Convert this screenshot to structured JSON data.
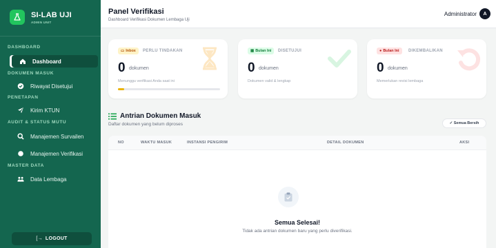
{
  "brand": {
    "title": "SI-LAB UJI",
    "subtitle": "ADMIN UNIT"
  },
  "sidebar": {
    "sections": [
      {
        "label": "DASHBOARD"
      },
      {
        "label": "DOKUMEN MASUK"
      },
      {
        "label": "PENETAPAN"
      },
      {
        "label": "AUDIT & STATUS MUTU"
      },
      {
        "label": "MASTER DATA"
      }
    ],
    "items": [
      {
        "label": "Dashboard",
        "icon": "home-icon",
        "active": true
      },
      {
        "label": "Riwayat Disetujui",
        "icon": "check-circle-icon"
      },
      {
        "label": "Kirim KTUN",
        "icon": "send-icon"
      },
      {
        "label": "Manajemen Survailen",
        "icon": "search-icon"
      },
      {
        "label": "Manajemen Verifikasi",
        "icon": "shield-check-icon"
      },
      {
        "label": "Data Lembaga",
        "icon": "users-icon"
      }
    ],
    "logout_label": "LOGOUT",
    "logout_glyph": "[→"
  },
  "header": {
    "title": "Panel Verifikasi",
    "subtitle": "Dashboard Verifikasi Dokumen Lembaga Uji",
    "user_name": "Administrator",
    "avatar_letter": "A"
  },
  "cards": [
    {
      "badge": "Inbox",
      "label": "PERLU TINDAKAN",
      "value": "0",
      "unit": "dokumen",
      "desc": "Menunggu verifikasi Anda saat ini",
      "progress_fraction": 0.06,
      "accent": "#eab308",
      "icon": "hourglass-icon"
    },
    {
      "badge": "Bulan Ini",
      "label": "DISETUJUI",
      "value": "0",
      "unit": "dokumen",
      "desc": "Dokumen valid & lengkap",
      "accent": "#22c55e",
      "icon": "check-icon"
    },
    {
      "badge": "Bulan Ini",
      "label": "DIKEMBALIKAN",
      "value": "0",
      "unit": "dokumen",
      "desc": "Memerlukan revisi lembaga",
      "accent": "#ef4444",
      "icon": "undo-icon"
    }
  ],
  "queue": {
    "title": "Antrian Dokumen Masuk",
    "subtitle": "Daftar dokumen yang belum diproses",
    "pill": "✓ Semua Bersih",
    "columns": [
      "NO",
      "WAKTU MASUK",
      "INSTANSI PENGIRIM",
      "DETAIL DOKUMEN",
      "AKSI"
    ],
    "empty_title": "Semua Selesai!",
    "empty_sub": "Tidak ada antrian dokumen baru yang perlu diverifikasi."
  },
  "colors": {
    "sidebar": "#14664f",
    "sidebar_active": "#0f4f3d",
    "accent_green": "#22c55e"
  }
}
